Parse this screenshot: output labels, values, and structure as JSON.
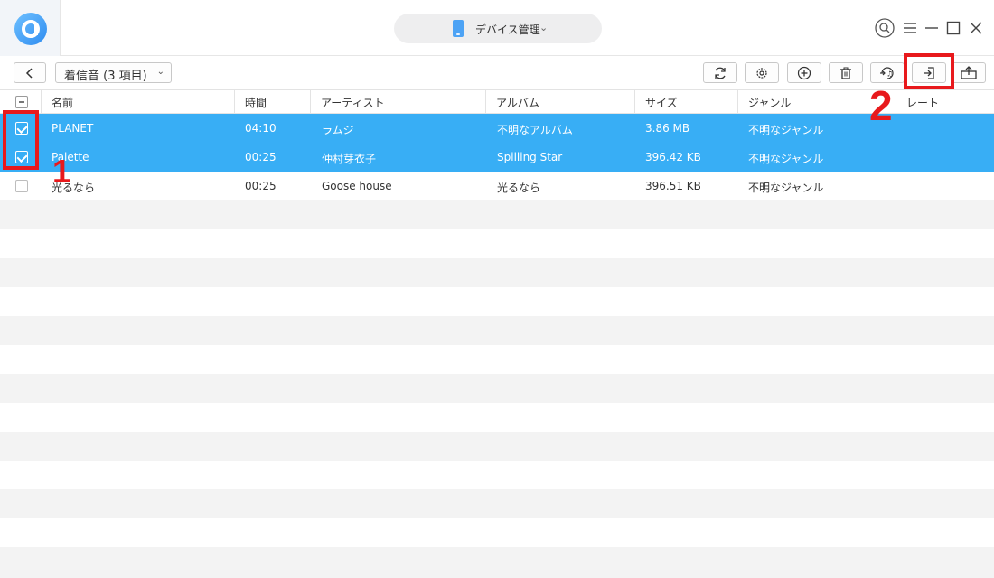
{
  "titlebar": {
    "device_label": "デバイス管理",
    "window_controls": [
      "search-icon",
      "menu-icon",
      "minimize-icon",
      "maximize-icon",
      "close-icon"
    ]
  },
  "toolbar": {
    "category_label": "着信音 (3 項目)",
    "buttons": [
      "refresh-icon",
      "settings-icon",
      "add-icon",
      "delete-icon",
      "to-itunes-icon",
      "to-computer-icon",
      "to-device-icon"
    ]
  },
  "table": {
    "columns": [
      "名前",
      "時間",
      "アーティスト",
      "アルバム",
      "サイズ",
      "ジャンル",
      "レート"
    ],
    "rows": [
      {
        "name": "PLANET",
        "time": "04:10",
        "artist": "ラムジ",
        "album": "不明なアルバム",
        "size": "3.86 MB",
        "genre": "不明なジャンル",
        "selected": true
      },
      {
        "name": "Palette",
        "time": "00:25",
        "artist": "仲村芽衣子",
        "album": "Spilling Star",
        "size": "396.42 KB",
        "genre": "不明なジャンル",
        "selected": true
      },
      {
        "name": "光るなら",
        "time": "00:25",
        "artist": "Goose house",
        "album": "光るなら",
        "size": "396.51 KB",
        "genre": "不明なジャンル",
        "selected": false
      }
    ]
  },
  "annotations": {
    "step1": "1",
    "step2": "2"
  },
  "colors": {
    "selected_row": "#38aef5",
    "highlight": "#e8191c",
    "accent": "#4da3f5"
  }
}
